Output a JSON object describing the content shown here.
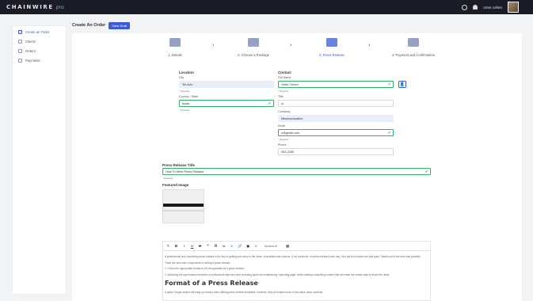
{
  "brand": {
    "name": "CHAINWIRE",
    "suffix": "pro"
  },
  "topbar": {
    "user_name": "omer cohen",
    "icons": [
      "settings-icon",
      "bell-icon"
    ]
  },
  "sidebar": {
    "items": [
      {
        "label": "Create an Order",
        "icon": "create-order-icon",
        "active": true
      },
      {
        "label": "Clients",
        "icon": "clients-icon",
        "active": false
      },
      {
        "label": "Orders",
        "icon": "orders-icon",
        "active": false
      },
      {
        "label": "Payments",
        "icon": "payments-icon",
        "active": false
      }
    ]
  },
  "header": {
    "title": "Create An Order",
    "save_draft": "Save Draft"
  },
  "steps": [
    {
      "label": "1. Details",
      "icon": "id-card-icon",
      "active": false
    },
    {
      "label": "2. Choose a Package",
      "icon": "package-icon",
      "active": false
    },
    {
      "label": "3. Press Release",
      "icon": "edit-icon",
      "active": true
    },
    {
      "label": "4. Payment and Confirmation",
      "icon": "credit-card-icon",
      "active": false
    }
  ],
  "location": {
    "title": "Location",
    "city_label": "City",
    "city_value": "Tel-Aviv",
    "city_required": "* Required",
    "country_label": "Country / State",
    "country_value": "Israel",
    "country_required": "* Required"
  },
  "contact": {
    "title": "Contact",
    "fullname_label": "Full Name",
    "fullname_value": "Omer Cohen",
    "fullname_required": "* Required",
    "title_label": "Title",
    "title_value": "ui",
    "company_label": "Company",
    "company_value": "Mkomsunication",
    "email_label": "Email",
    "email_value": "o@gmail.com",
    "email_required": "* Required",
    "phone_label": "Phone",
    "phone_value": "052-2255"
  },
  "press_release": {
    "title_label": "Press Release Title",
    "title_value": "How To Write Press Release",
    "title_required": "* Required",
    "featured_label": "Featured Image"
  },
  "toolbar": {
    "buttons": [
      "✎",
      "B",
      "I",
      "U",
      "S",
      "❝",
      "⌘",
      "≔",
      "≡",
      "🔗",
      "▣",
      "☺"
    ],
    "style_select": "Normal",
    "extra": "▦"
  },
  "editor": {
    "p1": "A professional and compelling press release is the key to getting your story in the news. Journalists scan dozens, if not hundreds, of press releases each day. Your job is to create one that pops. Stands out in the best way possible.",
    "p2": "There are two main components to writing a press release:",
    "p3": "1. Follow the appropriate format so it's recognizable as a press release.",
    "p4": "2. Achieving the right balance between a professional style and tone revealing types and establishing \"spending page, while creating compelling content that will make the reader want to share the news.",
    "heading": "Format of a Press Release",
    "p5": "A quick Google search will bring up various sites offering press release templates. However, they all contain much of the same basic contents."
  }
}
